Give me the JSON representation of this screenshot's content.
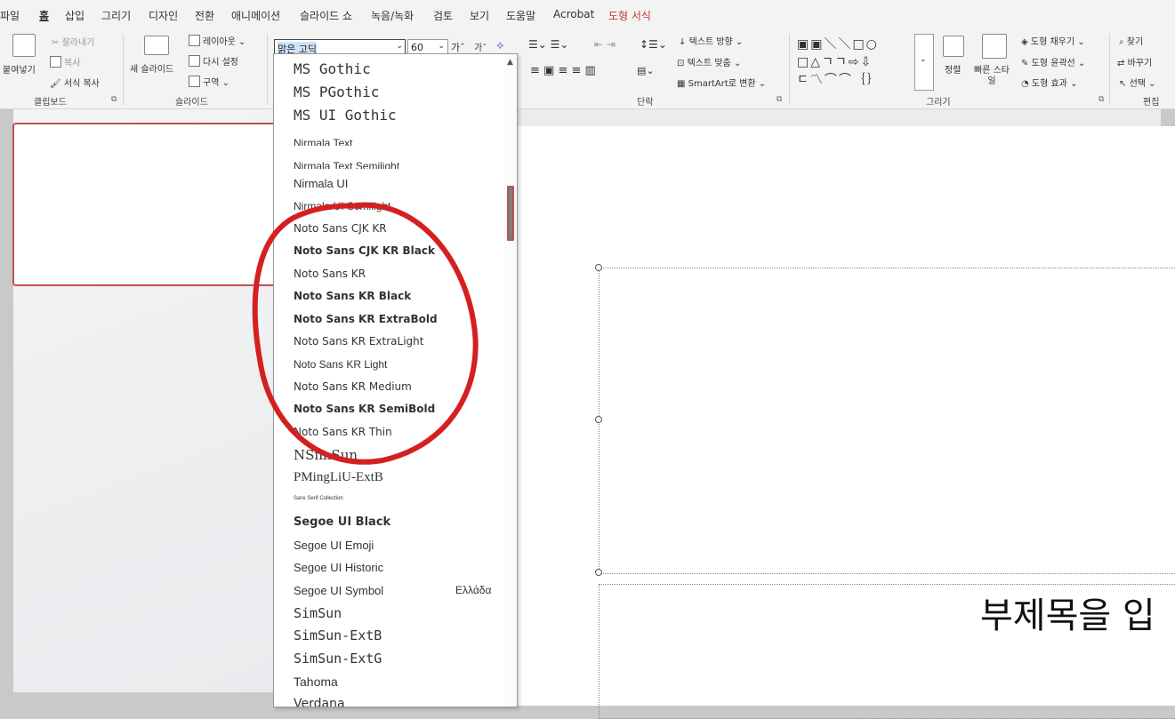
{
  "menubar": {
    "tabs": [
      "파일",
      "홈",
      "삽입",
      "그리기",
      "디자인",
      "전환",
      "애니메이션",
      "슬라이드 쇼",
      "녹음/녹화",
      "검토",
      "보기",
      "도움말",
      "Acrobat",
      "도형 서식"
    ]
  },
  "ribbon": {
    "clipboard": {
      "paste": "붙여넣기",
      "cut": "잘라내기",
      "copy": "복사",
      "format_painter": "서식 복사",
      "label": "클립보드"
    },
    "slides": {
      "new_slide": "새 슬라이드",
      "layout": "레이아웃",
      "reset": "다시 설정",
      "section": "구역",
      "label": "슬라이드"
    },
    "font": {
      "name": "맑은 고딕",
      "size": "60",
      "grow": "가ˆ",
      "shrink": "가ˇ"
    },
    "paragraph": {
      "text_direction": "텍스트 방향",
      "align_text": "텍스트 맞춤",
      "smartart": "SmartArt로 변환",
      "label": "단락"
    },
    "drawing": {
      "arrange": "정렬",
      "quick_styles": "빠른 스타일",
      "shape_fill": "도형 채우기",
      "shape_outline": "도형 윤곽선",
      "shape_effects": "도형 효과",
      "label": "그리기"
    },
    "editing": {
      "find": "찾기",
      "replace": "바꾸기",
      "select": "선택",
      "label": "편집"
    }
  },
  "font_list": [
    {
      "name": "MS Gothic"
    },
    {
      "name": "MS PGothic"
    },
    {
      "name": "MS UI Gothic"
    },
    {
      "name": "Nirmala Text"
    },
    {
      "name": "Nirmala Text Semilight"
    },
    {
      "name": "Nirmala UI"
    },
    {
      "name": "Nirmala UI Semilight"
    },
    {
      "name": "Noto Sans CJK KR"
    },
    {
      "name": "Noto Sans CJK KR Black"
    },
    {
      "name": "Noto Sans KR"
    },
    {
      "name": "Noto Sans KR Black"
    },
    {
      "name": "Noto Sans KR ExtraBold"
    },
    {
      "name": "Noto Sans KR ExtraLight"
    },
    {
      "name": "Noto Sans KR Light"
    },
    {
      "name": "Noto Sans KR Medium"
    },
    {
      "name": "Noto Sans KR SemiBold"
    },
    {
      "name": "Noto Sans KR Thin"
    },
    {
      "name": "NSimSun"
    },
    {
      "name": "PMingLiU-ExtB"
    },
    {
      "name": "Sans Serif Collection"
    },
    {
      "name": "Segoe UI Black"
    },
    {
      "name": "Segoe UI Emoji"
    },
    {
      "name": "Segoe UI Historic"
    },
    {
      "name": "Segoe UI Symbol",
      "preview": "Ελλάδα"
    },
    {
      "name": "SimSun"
    },
    {
      "name": "SimSun-ExtB"
    },
    {
      "name": "SimSun-ExtG"
    },
    {
      "name": "Tahoma"
    },
    {
      "name": "Verdana"
    }
  ],
  "slide": {
    "subtitle_placeholder": "부제목을 입"
  },
  "colors": {
    "context_tab": "#c0392b",
    "annotation": "#d42020",
    "thumb_border": "#c0504d"
  }
}
